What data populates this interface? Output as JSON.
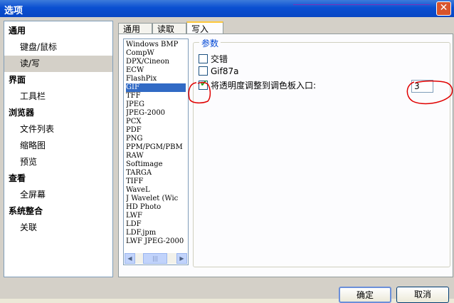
{
  "window": {
    "title": "选项"
  },
  "nav": {
    "categories": [
      {
        "label": "通用",
        "items": [
          "键盘/鼠标",
          "读/写"
        ]
      },
      {
        "label": "界面",
        "items": [
          "工具栏"
        ]
      },
      {
        "label": "浏览器",
        "items": [
          "文件列表",
          "缩略图",
          "预览"
        ]
      },
      {
        "label": "查看",
        "items": [
          "全屏幕"
        ]
      },
      {
        "label": "系统整合",
        "items": [
          "关联"
        ]
      }
    ],
    "selected": "读/写"
  },
  "tabs": [
    {
      "label": "通用",
      "active": false
    },
    {
      "label": "读取",
      "active": false
    },
    {
      "label": "写入",
      "active": true
    }
  ],
  "formats": [
    "Windows BMP",
    "CompW",
    "DPX/Cineon",
    "ECW",
    "FlashPix",
    "GIF",
    "TFF",
    "JPEG",
    "JPEG-2000",
    "PCX",
    "PDF",
    "PNG",
    "PPM/PGM/PBM",
    "RAW",
    "Softimage",
    "TARGA",
    "TIFF",
    "WaveL",
    "J Wavelet (Wic",
    "HD Photo",
    "LWF",
    "LDF",
    "LDF.jpm",
    "LWF JPEG-2000"
  ],
  "selected_format": "GIF",
  "params": {
    "legend": "参数",
    "options": [
      {
        "label": "交错",
        "checked": false
      },
      {
        "label": "Gif87a",
        "checked": false
      },
      {
        "label": "将透明度调整到调色板入口:",
        "checked": true
      }
    ],
    "palette_entry_value": "3"
  },
  "buttons": {
    "ok": "确定",
    "cancel": "取消"
  },
  "colors": {
    "title_bar": "#0a4fd1",
    "selection": "#316ac5",
    "annotation": "#e00000",
    "check": "#21a121"
  }
}
